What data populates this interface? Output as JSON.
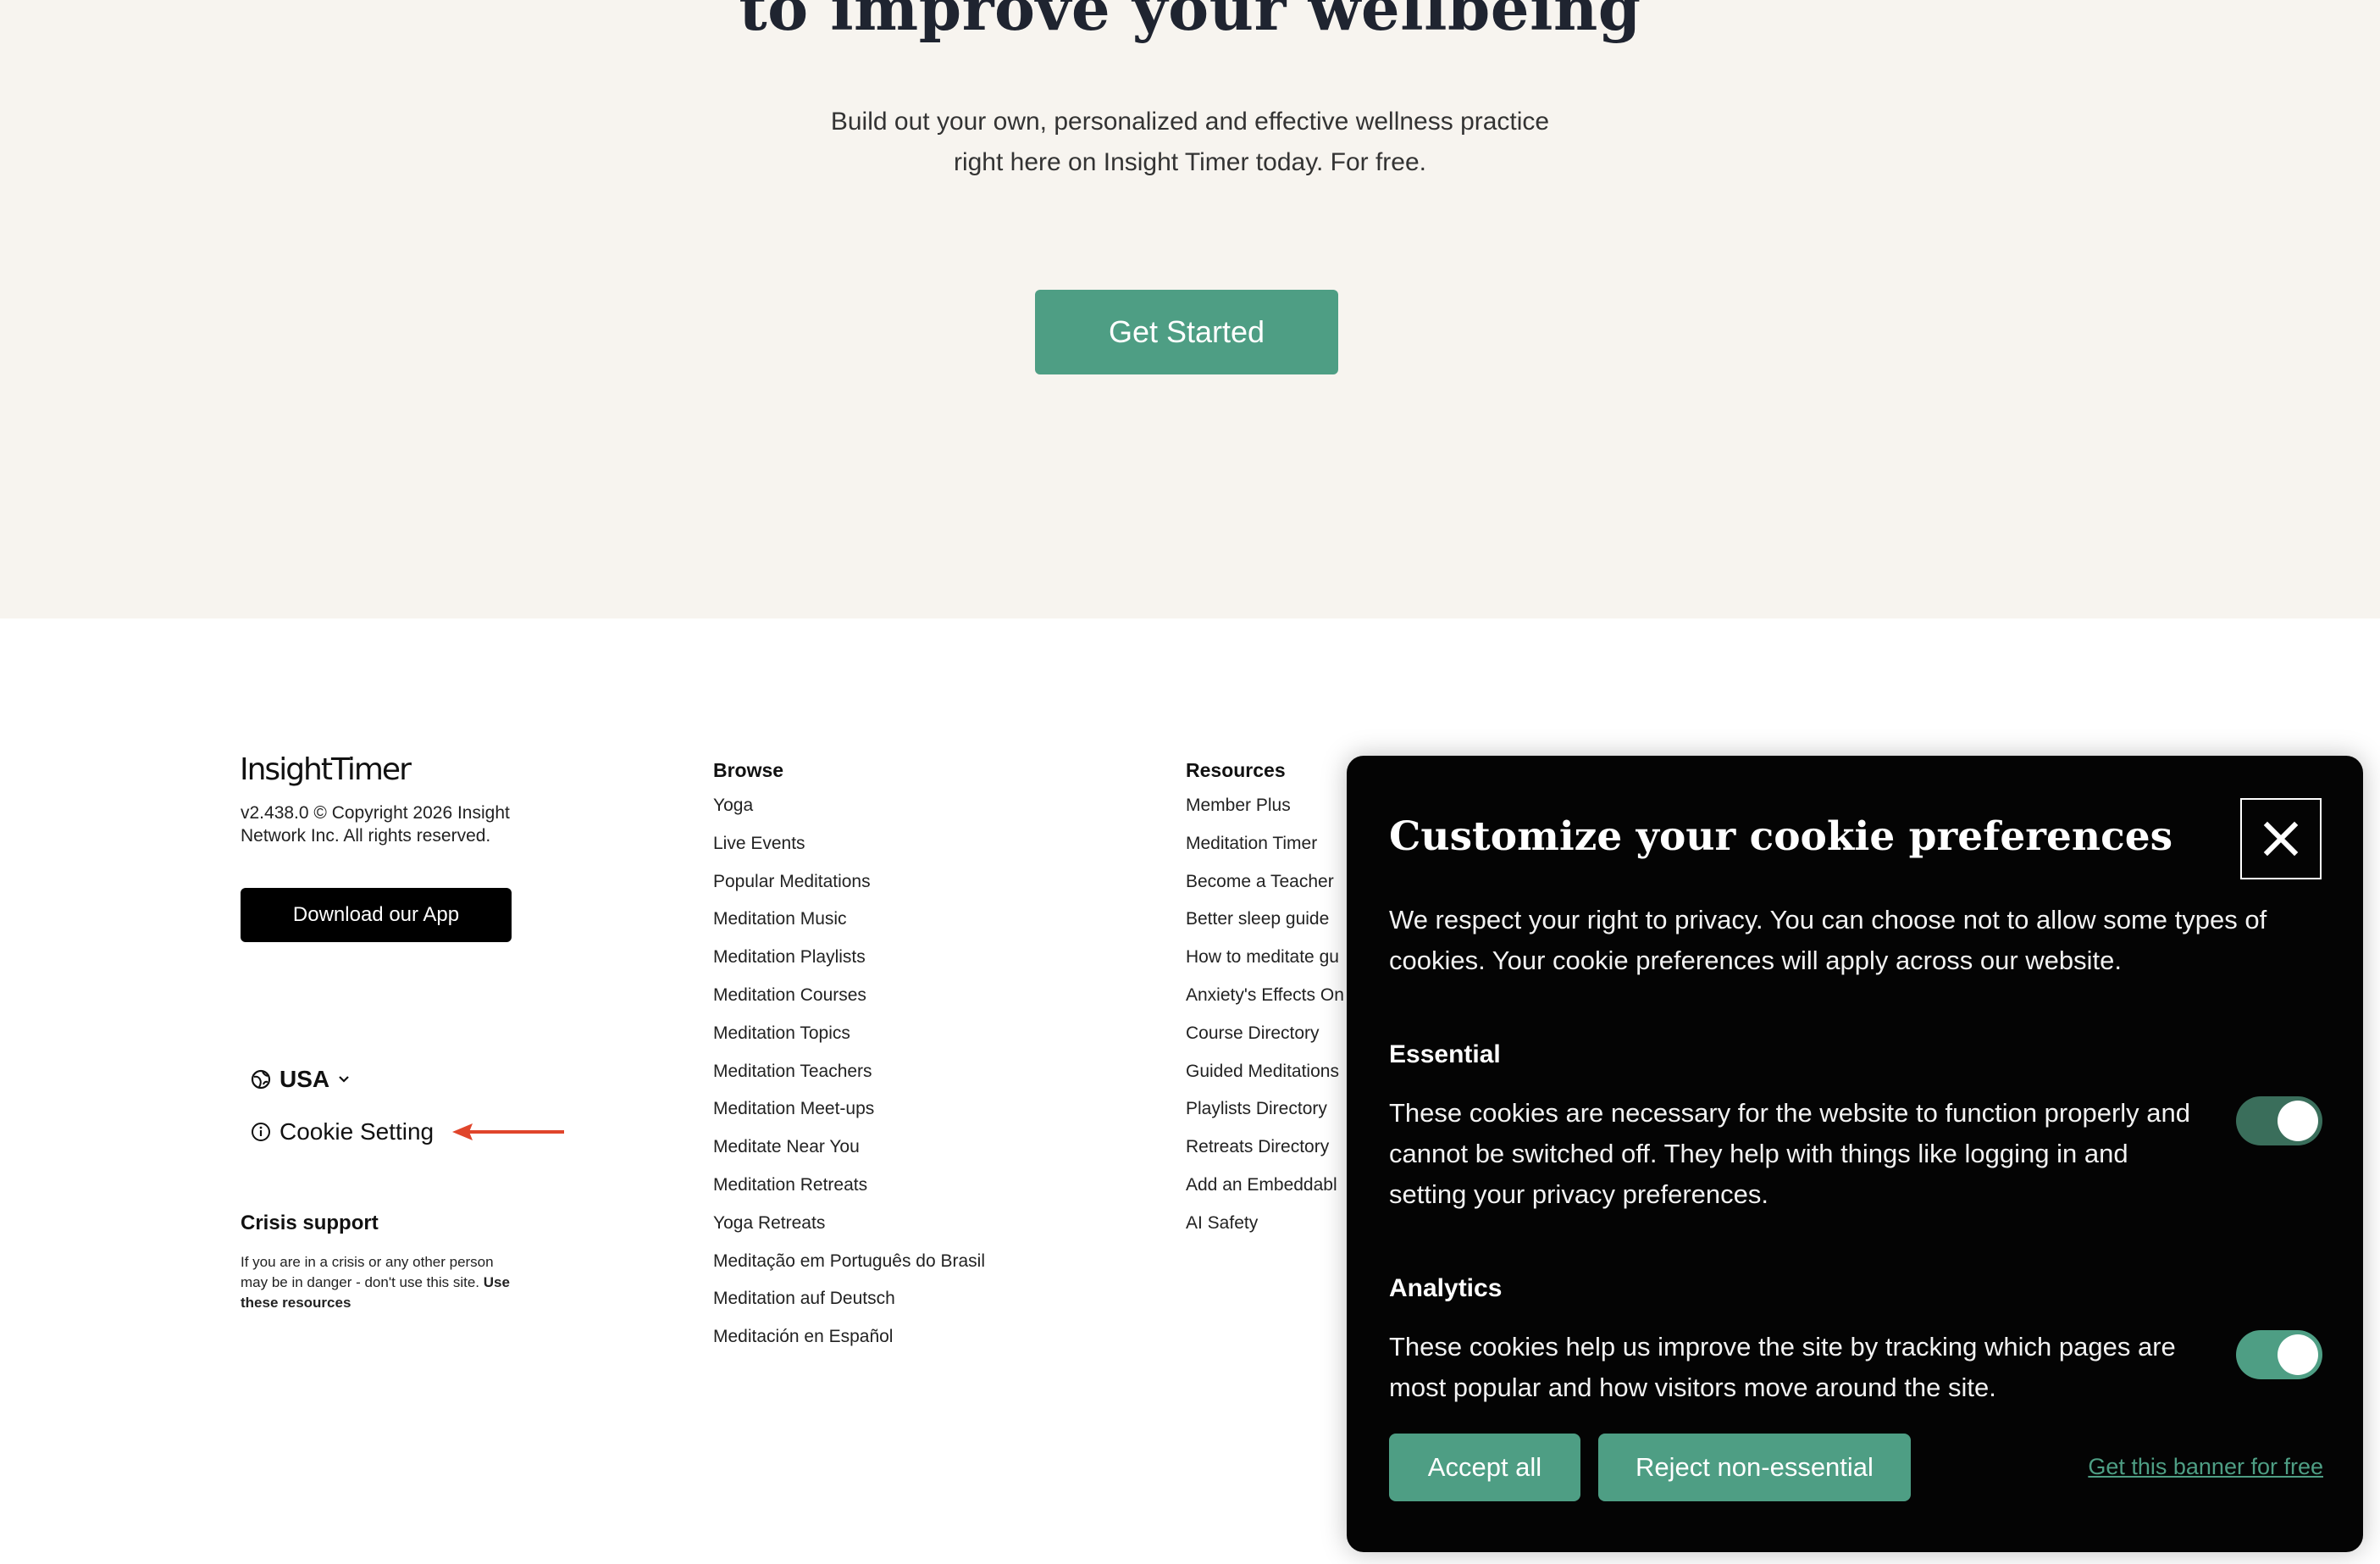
{
  "hero": {
    "title": "to improve your wellbeing",
    "subtitle_line1": "Build out your own, personalized and effective wellness practice",
    "subtitle_line2": "right here on Insight Timer today. For free.",
    "cta_label": "Get Started"
  },
  "footer": {
    "logo": "InsightTimer",
    "copyright": "v2.438.0 © Copyright 2026 Insight Network Inc. All rights reserved.",
    "download_label": "Download our App",
    "region_label": "USA",
    "cookie_setting_label": "Cookie Setting",
    "crisis_title": "Crisis support",
    "crisis_text": "If you are in a crisis or any other person may be in danger - don't use this site.",
    "crisis_link": "Use these resources",
    "browse": {
      "title": "Browse",
      "items": [
        "Yoga",
        "Live Events",
        "Popular Meditations",
        "Meditation Music",
        "Meditation Playlists",
        "Meditation Courses",
        "Meditation Topics",
        "Meditation Teachers",
        "Meditation Meet-ups",
        "Meditate Near You",
        "Meditation Retreats",
        "Yoga Retreats",
        "Meditação em Português do Brasil",
        "Meditation auf Deutsch",
        "Meditación en Español"
      ]
    },
    "resources": {
      "title": "Resources",
      "items": [
        "Member Plus",
        "Meditation Timer",
        "Become a Teacher",
        "Better sleep guide",
        "How to meditate gu",
        "Anxiety's Effects On",
        "Course Directory",
        "Guided Meditations",
        "Playlists Directory",
        "Retreats Directory",
        "Add an Embeddabl",
        "AI Safety"
      ]
    }
  },
  "cookie_modal": {
    "title": "Customize your cookie preferences",
    "intro": "We respect your right to privacy. You can choose not to allow some types of cookies. Your cookie preferences will apply across our website.",
    "essential_title": "Essential",
    "essential_text": "These cookies are necessary for the website to function properly and cannot be switched off. They help with things like logging in and setting your privacy preferences.",
    "analytics_title": "Analytics",
    "analytics_text": "These cookies help us improve the site by tracking which pages are most popular and how visitors move around the site.",
    "accept_label": "Accept all",
    "reject_label": "Reject non-essential",
    "banner_link": "Get this banner for free",
    "essential_enabled": true,
    "analytics_enabled": true
  },
  "colors": {
    "accent": "#4e9e84",
    "hero_bg": "#f7f4ef",
    "annotation_arrow": "#e0452b"
  }
}
